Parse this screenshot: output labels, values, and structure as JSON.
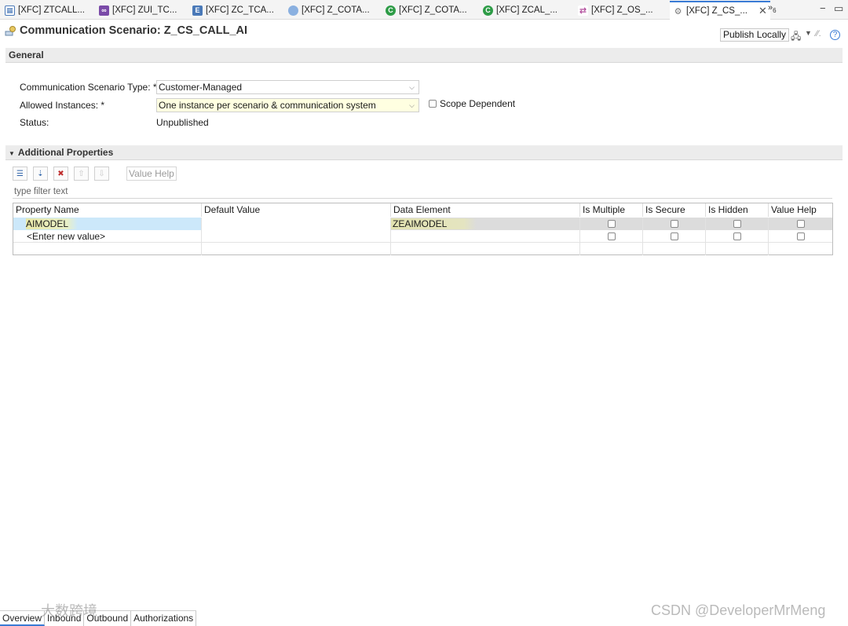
{
  "tabs": [
    {
      "label": "[XFC] ZTCALL...",
      "icon": "table-icon",
      "color": "#4a79b8"
    },
    {
      "label": "[XFC] ZUI_TC...",
      "icon": "service-binding-icon",
      "color": "#7a4aa8"
    },
    {
      "label": "[XFC] ZC_TCA...",
      "icon": "entity-icon",
      "color": "#4a79b8"
    },
    {
      "label": "[XFC] Z_COTA...",
      "icon": "circle-icon",
      "color": "#8ab0e0"
    },
    {
      "label": "[XFC] Z_COTA...",
      "icon": "class-icon",
      "color": "#2e9c47"
    },
    {
      "label": "[XFC] ZCAL_...",
      "icon": "class-icon",
      "color": "#2e9c47"
    },
    {
      "label": "[XFC] Z_OS_...",
      "icon": "outbound-service-icon",
      "color": "#b04a9a"
    },
    {
      "label": "[XFC] Z_CS_...",
      "icon": "communication-scenario-icon",
      "color": "#888888"
    }
  ],
  "overflow": {
    "label": "»",
    "count": "6"
  },
  "header": {
    "title": "Communication Scenario: Z_CS_CALL_AI",
    "publish_label": "Publish Locally"
  },
  "general": {
    "section_label": "General",
    "type_label": "Communication Scenario Type: *",
    "type_value": "Customer-Managed",
    "instances_label": "Allowed Instances: *",
    "instances_value": "One instance per scenario & communication system",
    "scope_label": "Scope Dependent",
    "scope_checked": false,
    "status_label": "Status:",
    "status_value": "Unpublished"
  },
  "additional": {
    "section_label": "Additional Properties",
    "value_help_button": "Value Help",
    "filter_placeholder": "type filter text",
    "columns": [
      "Property Name",
      "Default Value",
      "Data Element",
      "Is Multiple",
      "Is Secure",
      "Is Hidden",
      "Value Help"
    ],
    "rows": [
      {
        "property": "AIMODEL",
        "default": "",
        "data_element": "ZEAIMODEL",
        "is_multiple": false,
        "is_secure": false,
        "is_hidden": false,
        "value_help": false
      },
      {
        "property": "<Enter new value>",
        "default": "",
        "data_element": "",
        "is_multiple": false,
        "is_secure": false,
        "is_hidden": false,
        "value_help": false
      }
    ]
  },
  "bottom_tabs": [
    "Overview",
    "Inbound",
    "Outbound",
    "Authorizations"
  ],
  "watermarks": {
    "left": "大数跨境",
    "right": "CSDN @DeveloperMrMeng"
  },
  "colors": {
    "accent": "#3a7bd5",
    "highlight_yellow": "#ffffe1",
    "selection_blue": "#cce8fa"
  }
}
